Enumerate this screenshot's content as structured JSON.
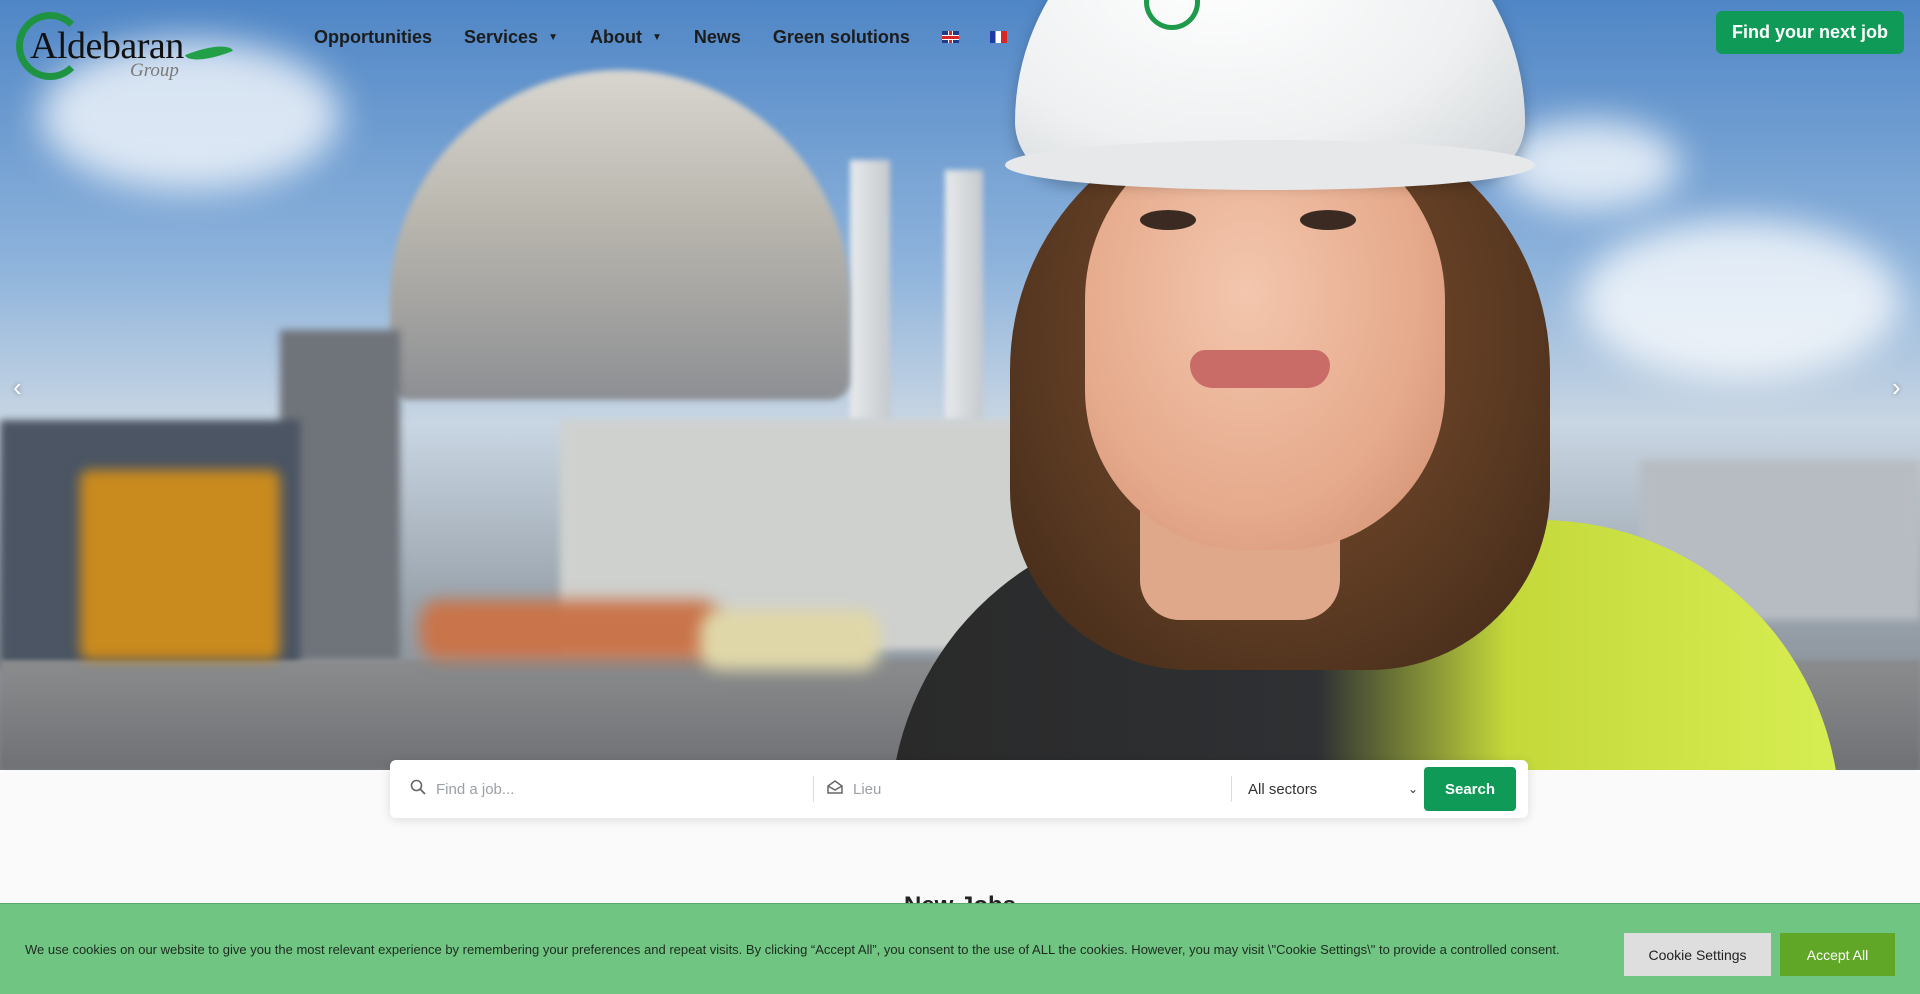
{
  "brand": {
    "name": "Aldebaran",
    "tagline": "Group"
  },
  "nav": {
    "items": [
      {
        "label": "Opportunities",
        "has_dropdown": false
      },
      {
        "label": "Services",
        "has_dropdown": true
      },
      {
        "label": "About",
        "has_dropdown": true
      },
      {
        "label": "News",
        "has_dropdown": false
      },
      {
        "label": "Green solutions",
        "has_dropdown": false
      }
    ],
    "languages": [
      "flag-uk-icon",
      "flag-fr-icon"
    ],
    "cta_label": "Find your next job"
  },
  "hero": {
    "prev_icon": "‹",
    "next_icon": "›"
  },
  "search": {
    "job_placeholder": "Find a job...",
    "location_placeholder": "Lieu",
    "sector_selected": "All sectors",
    "button_label": "Search"
  },
  "section": {
    "title": "New Jobs"
  },
  "cookie": {
    "text": "We use cookies on our website to give you the most relevant experience by remembering your preferences and repeat visits. By clicking “Accept All”, you consent to the use of ALL the cookies. However, you may visit \\\"Cookie Settings\\\" to provide a controlled consent.",
    "settings_label": "Cookie Settings",
    "accept_label": "Accept All"
  },
  "colors": {
    "accent": "#0f9a58",
    "cookie_bg": "#6fc581",
    "accept": "#61a727"
  }
}
